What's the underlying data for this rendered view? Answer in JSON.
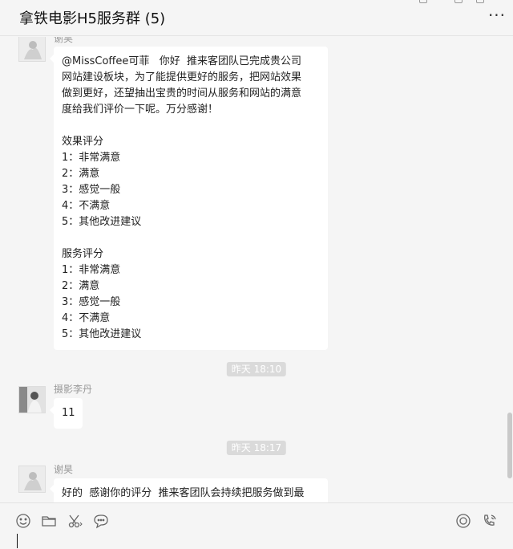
{
  "window": {
    "title": "拿铁电影H5服务群 (5)"
  },
  "messages": [
    {
      "sender": "谢昊",
      "lines": [
        "@MissCoffee可菲   你好  推来客团队已完成贵公司",
        "网站建设板块，为了能提供更好的服务，把网站效果",
        "做到更好，还望抽出宝贵的时间从服务和网站的满意",
        "度给我们评价一下呢。万分感谢！",
        "",
        "效果评分",
        "1：非常满意",
        "2：满意",
        "3：感觉一般",
        "4：不满意",
        "5：其他改进建议",
        "",
        "服务评分",
        "1：非常满意",
        "2：满意",
        "3：感觉一般",
        "4：不满意",
        "5：其他改进建议"
      ]
    },
    {
      "time": "昨天 18:10",
      "sender": "摄影李丹",
      "lines": [
        "11"
      ]
    },
    {
      "time": "昨天 18:17",
      "sender": "谢昊",
      "lines": [
        "好的  感谢你的评分  推来客团队会持续把服务做到最"
      ]
    }
  ],
  "toolbar": {
    "icons": [
      "emoji-icon",
      "folder-icon",
      "scissors-icon",
      "chat-bubble-icon",
      "camera-icon",
      "phone-icon"
    ]
  },
  "colors": {
    "background": "#f5f5f5",
    "bubble": "#ffffff",
    "timestamp_bg": "#dadada"
  }
}
